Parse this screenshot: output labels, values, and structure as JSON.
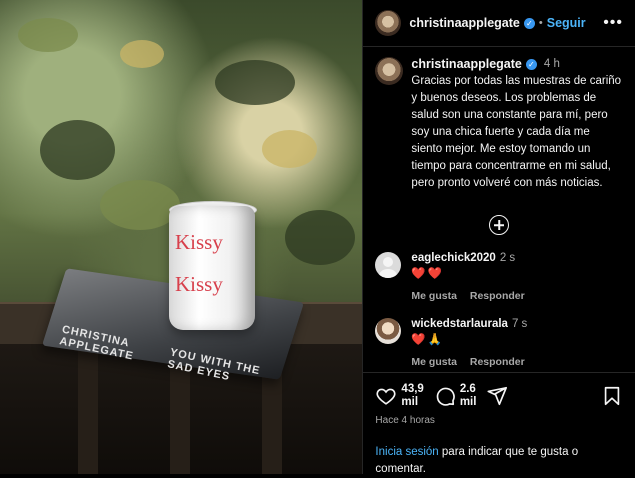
{
  "post": {
    "username": "christinaapplegate",
    "follow_label": "Seguir",
    "time": "4 h",
    "caption": "Gracias por todas las muestras de cariño y buenos deseos. Los problemas de salud son una constante para mí, pero soy una chica fuerte y cada día me siento mejor. Me estoy tomando un tiempo para concentrarme en mi salud, pero pronto volveré con más noticias."
  },
  "photo": {
    "mug_text": "Kissy",
    "book_left": "CHRISTINA APPLEGATE",
    "book_right": "YOU WITH THE SAD EYES"
  },
  "comments": [
    {
      "user": "eaglechick2020",
      "time": "2 s",
      "text": "❤️❤️",
      "like": "Me gusta",
      "reply": "Responder"
    },
    {
      "user": "wickedstarlaurala",
      "time": "7 s",
      "text": "❤️🙏",
      "like": "Me gusta",
      "reply": "Responder"
    }
  ],
  "stats": {
    "likes": "43,9\nmil",
    "comments": "2.6\nmil",
    "ago": "Hace 4 horas"
  },
  "login": {
    "link": "Inicia sesión",
    "text": " para indicar que te gusta o comentar."
  },
  "icons": [
    "verified-badge",
    "more-icon",
    "add-icon",
    "heart-icon",
    "comment-icon",
    "share-icon",
    "bookmark-icon"
  ]
}
